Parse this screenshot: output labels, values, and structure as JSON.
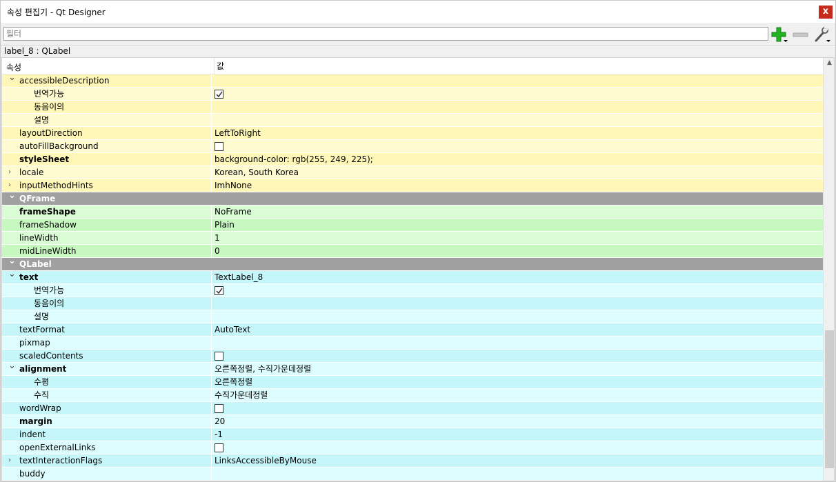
{
  "window": {
    "title": "속성 편집기 - Qt Designer",
    "close_label": "x"
  },
  "toolbar": {
    "filter_placeholder": "필터",
    "add_icon": "plus-icon",
    "remove_icon": "minus-icon",
    "config_icon": "wrench-icon"
  },
  "object_line": "label_8 : QLabel",
  "header": {
    "property": "속성",
    "value": "값"
  },
  "rows": [
    {
      "name": "accessibleDescription",
      "value": "",
      "kind": "prop",
      "color": "y2",
      "arrow": "expanded"
    },
    {
      "name": "번역가능",
      "value": "",
      "kind": "sub",
      "color": "y1",
      "checkbox": true,
      "checked": true
    },
    {
      "name": "동음이의",
      "value": "",
      "kind": "sub",
      "color": "y2"
    },
    {
      "name": "설명",
      "value": "",
      "kind": "sub",
      "color": "y1"
    },
    {
      "name": "layoutDirection",
      "value": "LeftToRight",
      "kind": "prop",
      "color": "y2"
    },
    {
      "name": "autoFillBackground",
      "value": "",
      "kind": "prop",
      "color": "y1",
      "checkbox": true,
      "checked": false
    },
    {
      "name": "styleSheet",
      "value": "background-color: rgb(255, 249, 225);",
      "kind": "prop",
      "color": "y2",
      "bold": true
    },
    {
      "name": "locale",
      "value": "Korean, South Korea",
      "kind": "prop",
      "color": "y1",
      "arrow": "collapsed"
    },
    {
      "name": "inputMethodHints",
      "value": "ImhNone",
      "kind": "prop",
      "color": "y2",
      "arrow": "collapsed"
    },
    {
      "name": "QFrame",
      "value": "",
      "kind": "cat",
      "arrow": "expanded"
    },
    {
      "name": "frameShape",
      "value": "NoFrame",
      "kind": "prop",
      "color": "g1",
      "bold": true
    },
    {
      "name": "frameShadow",
      "value": "Plain",
      "kind": "prop",
      "color": "g2"
    },
    {
      "name": "lineWidth",
      "value": "1",
      "kind": "prop",
      "color": "g1"
    },
    {
      "name": "midLineWidth",
      "value": "0",
      "kind": "prop",
      "color": "g2"
    },
    {
      "name": "QLabel",
      "value": "",
      "kind": "cat",
      "arrow": "expanded"
    },
    {
      "name": "text",
      "value": "TextLabel_8",
      "kind": "prop",
      "color": "c2",
      "bold": true,
      "arrow": "expanded"
    },
    {
      "name": "번역가능",
      "value": "",
      "kind": "sub",
      "color": "c1",
      "checkbox": true,
      "checked": true
    },
    {
      "name": "동음이의",
      "value": "",
      "kind": "sub",
      "color": "c2"
    },
    {
      "name": "설명",
      "value": "",
      "kind": "sub",
      "color": "c1"
    },
    {
      "name": "textFormat",
      "value": "AutoText",
      "kind": "prop",
      "color": "c2"
    },
    {
      "name": "pixmap",
      "value": "",
      "kind": "prop",
      "color": "c1"
    },
    {
      "name": "scaledContents",
      "value": "",
      "kind": "prop",
      "color": "c2",
      "checkbox": true,
      "checked": false
    },
    {
      "name": "alignment",
      "value": "오른쪽정렬, 수직가운데정렬",
      "kind": "prop",
      "color": "c1",
      "bold": true,
      "arrow": "expanded"
    },
    {
      "name": "수평",
      "value": "오른쪽정렬",
      "kind": "sub",
      "color": "c2"
    },
    {
      "name": "수직",
      "value": "수직가운데정렬",
      "kind": "sub",
      "color": "c1"
    },
    {
      "name": "wordWrap",
      "value": "",
      "kind": "prop",
      "color": "c2",
      "checkbox": true,
      "checked": false
    },
    {
      "name": "margin",
      "value": "20",
      "kind": "prop",
      "color": "c1",
      "bold": true
    },
    {
      "name": "indent",
      "value": "-1",
      "kind": "prop",
      "color": "c2"
    },
    {
      "name": "openExternalLinks",
      "value": "",
      "kind": "prop",
      "color": "c1",
      "checkbox": true,
      "checked": false
    },
    {
      "name": "textInteractionFlags",
      "value": "LinksAccessibleByMouse",
      "kind": "prop",
      "color": "c2",
      "arrow": "collapsed"
    },
    {
      "name": "buddy",
      "value": "",
      "kind": "prop",
      "color": "c1"
    }
  ]
}
